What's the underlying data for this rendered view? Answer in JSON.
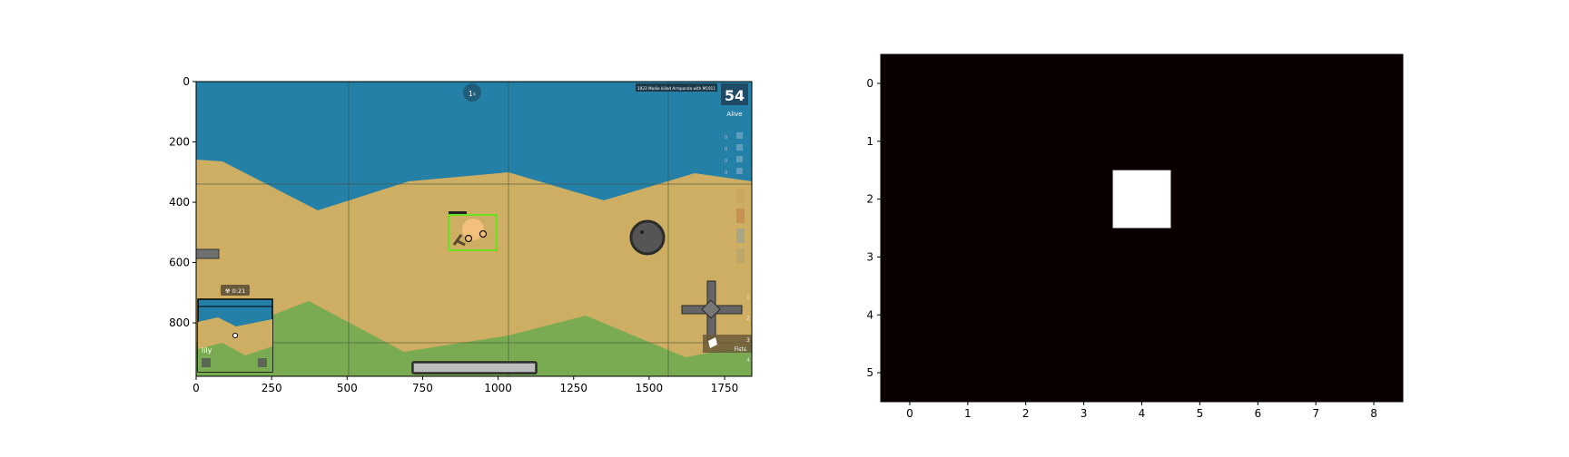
{
  "left_panel": {
    "x_ticks": [
      "0",
      "250",
      "500",
      "750",
      "1000",
      "1250",
      "1500",
      "1750"
    ],
    "y_ticks": [
      "0",
      "200",
      "400",
      "600",
      "800"
    ],
    "game": {
      "sky_color": "#2580a8",
      "sand_color": "#cdae62",
      "grass_color": "#7aab52",
      "grid_color": "#3b4a3a",
      "highlight_color": "#66e01f",
      "compass_text": "1‹",
      "killfeed_text": "1923 Madie killed Armpanda with M1911",
      "alive_count": "54",
      "alive_label": "Alive",
      "gas_timer_text": "☢ 0:21",
      "weapon_slot_label": "Fists",
      "weapon_slot_numbers": [
        "1",
        "2",
        "3",
        "4"
      ],
      "minimap_label": "lily",
      "health_bar_fill_fraction": 1.0,
      "inventory_counts": [
        "0",
        "0",
        "0",
        "0"
      ]
    }
  },
  "right_panel": {
    "x_ticks": [
      "0",
      "1",
      "2",
      "3",
      "4",
      "5",
      "6",
      "7",
      "8"
    ],
    "y_ticks": [
      "0",
      "1",
      "2",
      "3",
      "4",
      "5"
    ],
    "grid_cols": 9,
    "grid_rows": 6,
    "background_color": "#0b0000",
    "active_cell_color": "#ffffff",
    "active_cell": {
      "col": 4,
      "row": 2
    }
  }
}
